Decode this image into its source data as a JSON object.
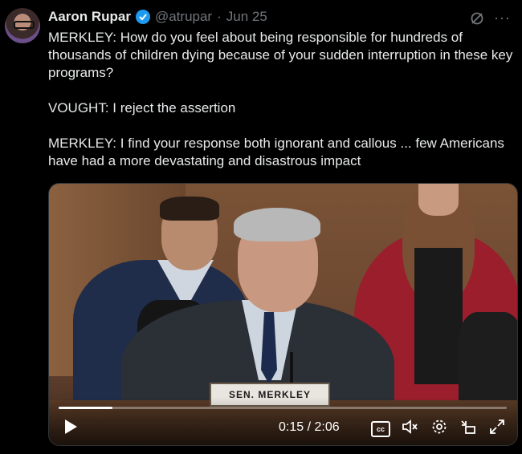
{
  "tweet": {
    "author_name": "Aaron Rupar",
    "handle": "@atrupar",
    "separator": "·",
    "date": "Jun 25",
    "text": "MERKLEY: How do you feel about being responsible for hundreds of thousands of children dying because of your sudden interruption in these key programs?\n\nVOUGHT: I reject the assertion\n\nMERKLEY: I find your response both ignorant and callous ... few Americans have had a more devastating and disastrous impact"
  },
  "video": {
    "nameplate": "SEN. MERKLEY",
    "current_time": "0:15",
    "duration": "2:06",
    "time_display": "0:15 / 2:06",
    "progress": 0.12,
    "cc_label": "cc"
  },
  "colors": {
    "verified": "#1d9bf0",
    "background": "#000000",
    "muted_text": "#71767b"
  },
  "icons": [
    "verified-badge-icon",
    "grok-icon",
    "more-icon",
    "play-icon",
    "closed-captions-icon",
    "mute-icon",
    "settings-icon",
    "pip-icon",
    "fullscreen-icon"
  ]
}
